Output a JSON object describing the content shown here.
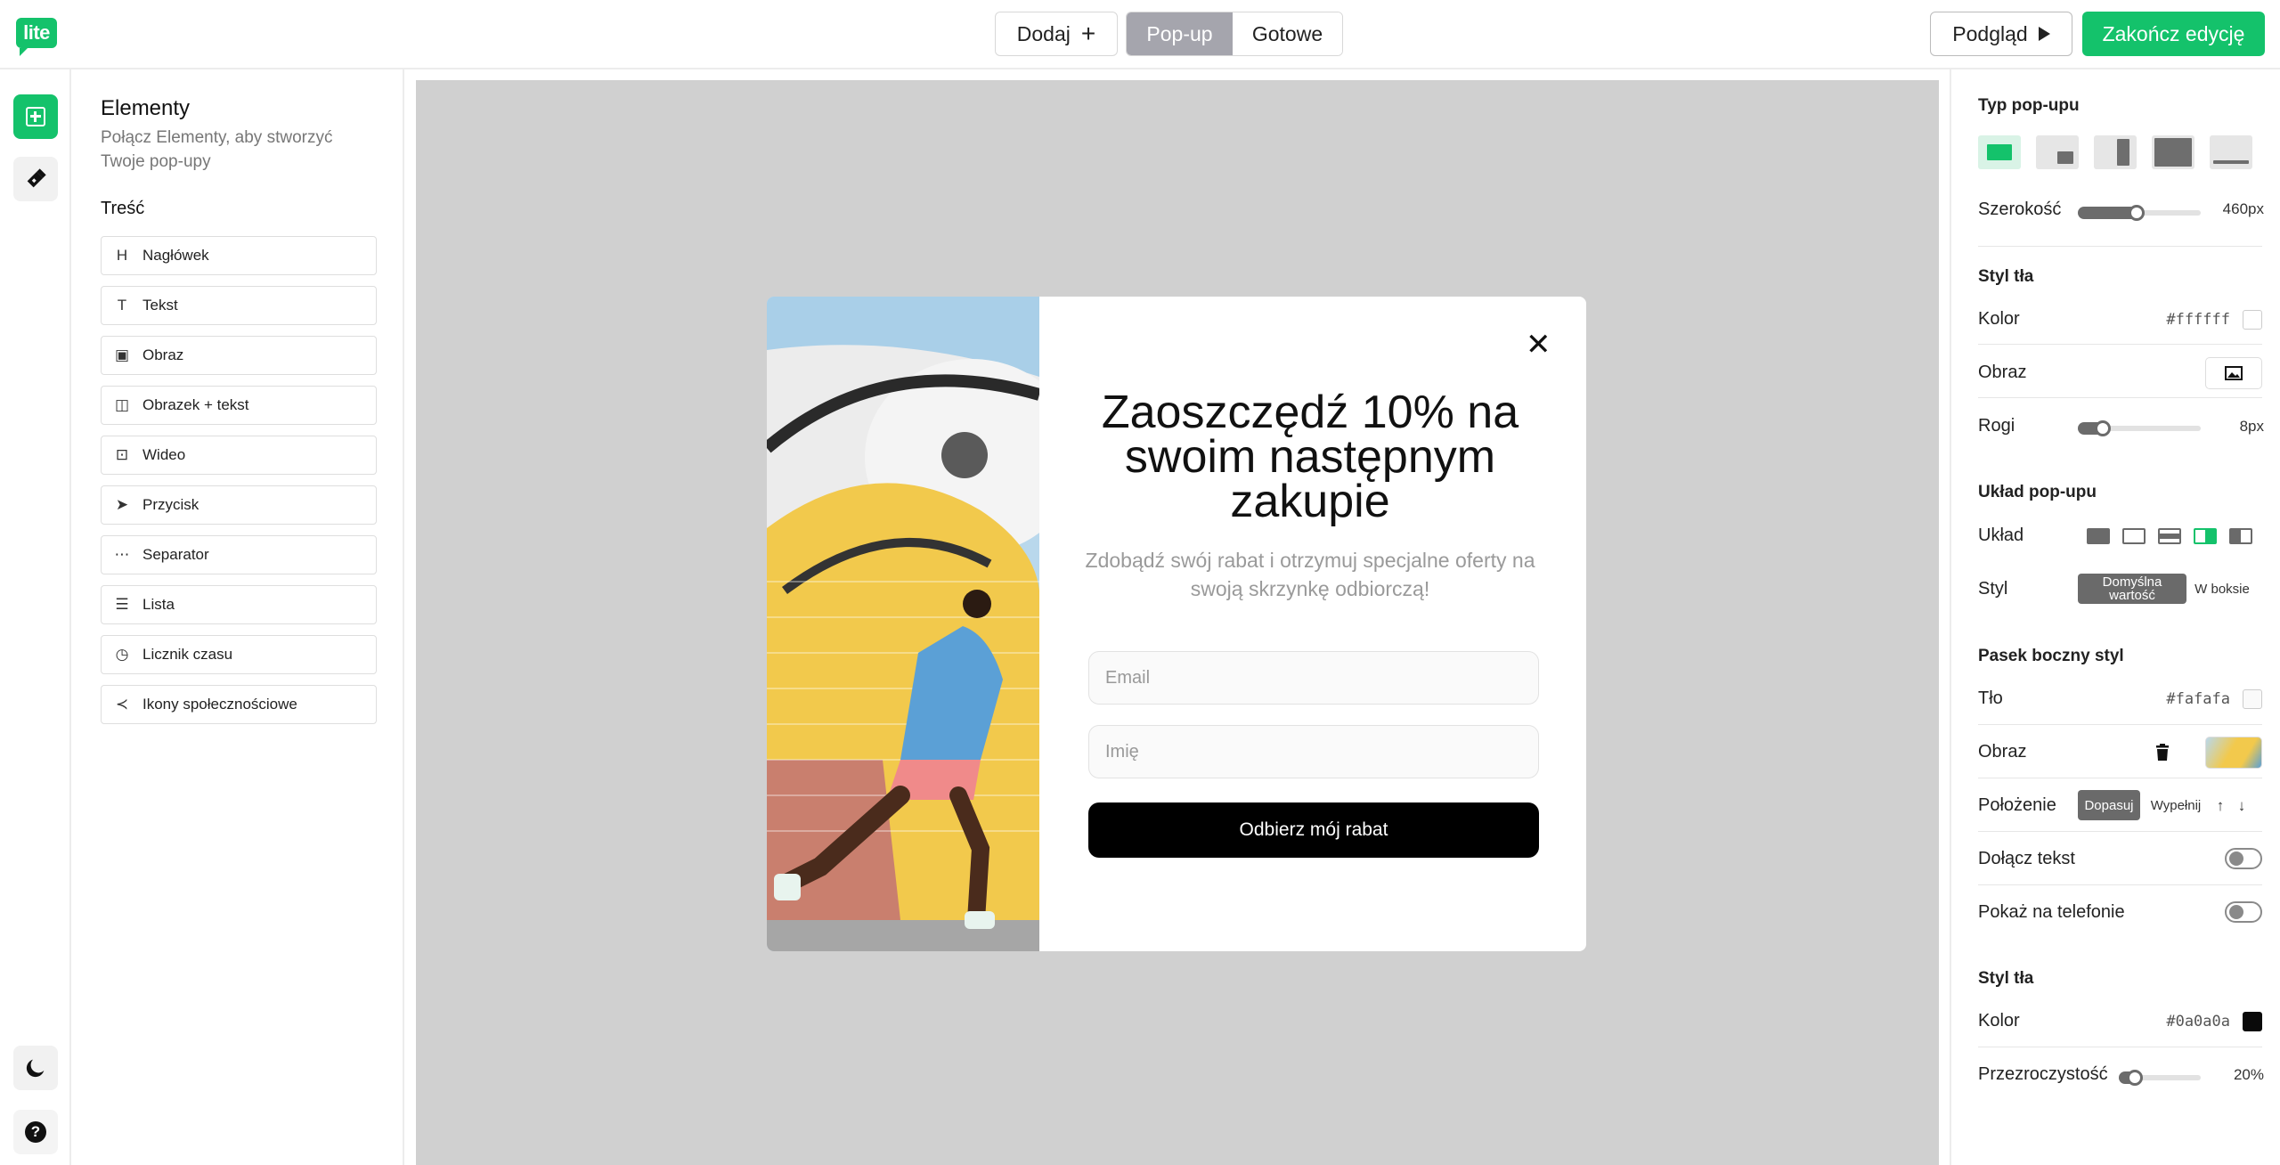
{
  "app": {
    "logo_text": "lite"
  },
  "topbar": {
    "add_label": "Dodaj",
    "tabs": [
      {
        "label": "Pop-up",
        "active": true
      },
      {
        "label": "Gotowe",
        "active": false
      }
    ],
    "preview_label": "Podgląd",
    "finish_label": "Zakończ edycję",
    "accent_color": "#14c26b"
  },
  "rail": {
    "icons": [
      "add-square-icon",
      "paint-brush-icon",
      "moon-icon",
      "help-icon"
    ]
  },
  "elements_panel": {
    "title": "Elementy",
    "subtitle": "Połącz Elementy, aby stworzyć Twoje pop-upy",
    "section": "Treść",
    "items": [
      {
        "label": "Nagłówek",
        "icon": "heading-icon",
        "glyph": "H"
      },
      {
        "label": "Tekst",
        "icon": "text-icon",
        "glyph": "T"
      },
      {
        "label": "Obraz",
        "icon": "image-icon",
        "glyph": "▣"
      },
      {
        "label": "Obrazek + tekst",
        "icon": "image-text-icon",
        "glyph": "◫"
      },
      {
        "label": "Wideo",
        "icon": "video-icon",
        "glyph": "⊡"
      },
      {
        "label": "Przycisk",
        "icon": "cursor-icon",
        "glyph": "➤"
      },
      {
        "label": "Separator",
        "icon": "separator-icon",
        "glyph": "⋯"
      },
      {
        "label": "Lista",
        "icon": "list-icon",
        "glyph": "☰"
      },
      {
        "label": "Licznik czasu",
        "icon": "timer-icon",
        "glyph": "◷"
      },
      {
        "label": "Ikony społecznościowe",
        "icon": "share-icon",
        "glyph": "≺"
      }
    ]
  },
  "popup": {
    "headline": "Zaoszczędź 10% na swoim następnym zakupie",
    "subtext": "Zdobądź swój rabat i otrzymuj specjalne oferty na swoją skrzynkę odbiorczą!",
    "email_placeholder": "Email",
    "name_placeholder": "Imię",
    "cta_label": "Odbierz mój rabat",
    "close_glyph": "✕"
  },
  "settings": {
    "popup_type_title": "Typ pop-upu",
    "width_label": "Szerokość",
    "width_value": "460px",
    "width_fraction": 0.48,
    "bg_style_title": "Styl tła",
    "color_label": "Kolor",
    "color_value": "#ffffff",
    "image_label": "Obraz",
    "corners_label": "Rogi",
    "corners_value": "8px",
    "corners_fraction": 0.2,
    "layout_title": "Układ pop-upu",
    "layout_label": "Układ",
    "style_label": "Styl",
    "style_default": "Domyślna wartość",
    "style_boxed": "W boksie",
    "sidebar_title": "Pasek boczny styl",
    "sidebar_bg_label": "Tło",
    "sidebar_bg_value": "#fafafa",
    "sidebar_image_label": "Obraz",
    "position_label": "Położenie",
    "position_fit": "Dopasuj",
    "position_fill": "Wypełnij",
    "attach_text_label": "Dołącz tekst",
    "show_phone_label": "Pokaż na telefonie",
    "overlay_title": "Styl tła",
    "overlay_color_label": "Kolor",
    "overlay_color_value": "#0a0a0a",
    "opacity_label": "Przezroczystość",
    "opacity_value": "20%",
    "opacity_fraction": 0.2
  }
}
